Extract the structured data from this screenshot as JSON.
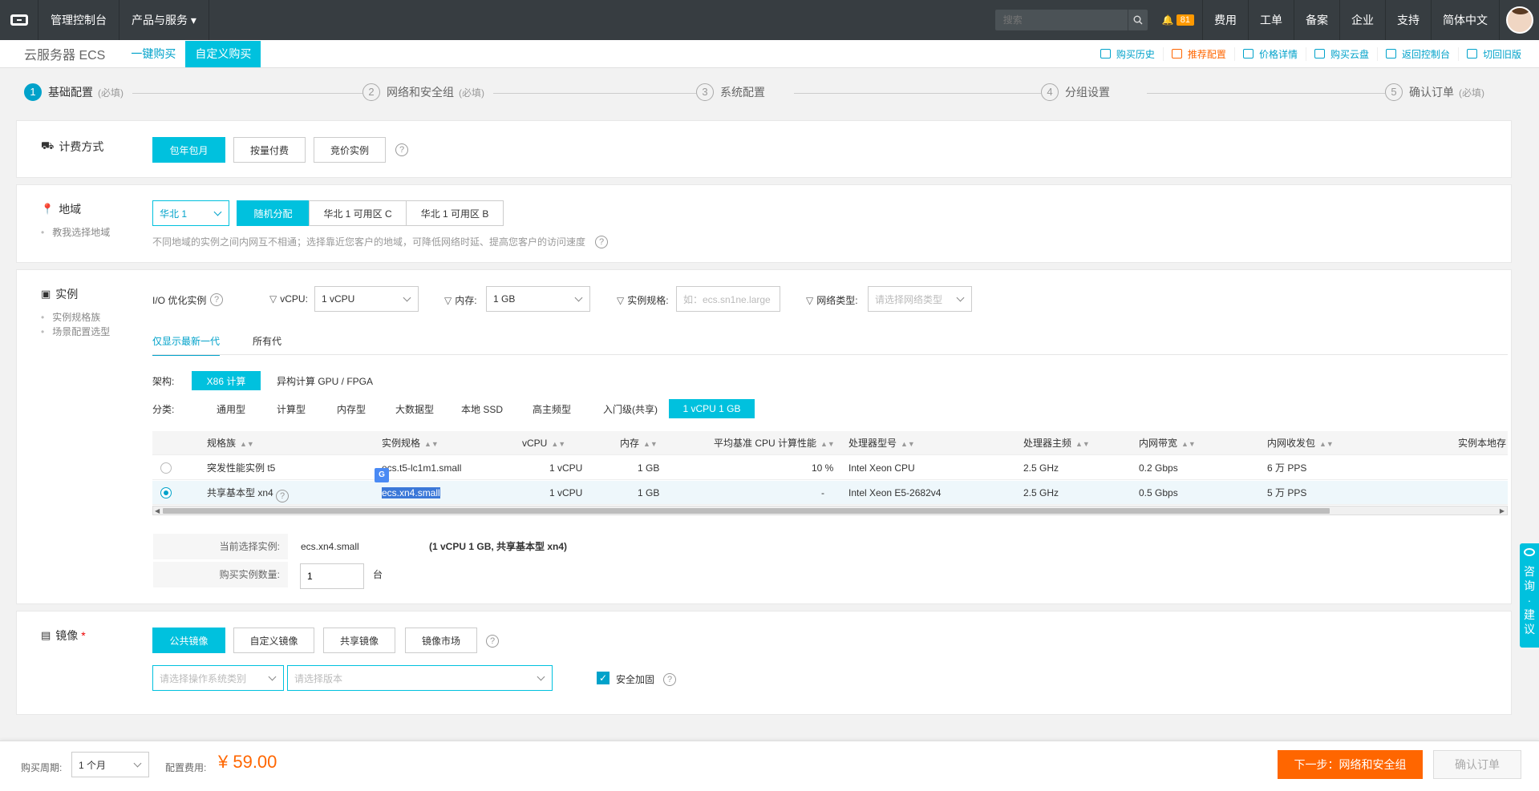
{
  "topbar": {
    "console": "管理控制台",
    "products": "产品与服务",
    "search_placeholder": "搜索",
    "notifications": "81",
    "links": [
      "费用",
      "工单",
      "备案",
      "企业",
      "支持",
      "简体中文"
    ]
  },
  "subbar": {
    "title": "云服务器 ECS",
    "tabs": [
      "一键购买",
      "自定义购买"
    ],
    "links": [
      "购买历史",
      "推荐配置",
      "价格详情",
      "购买云盘",
      "返回控制台",
      "切回旧版"
    ]
  },
  "steps": [
    {
      "num": "1",
      "label": "基础配置",
      "req": "(必填)"
    },
    {
      "num": "2",
      "label": "网络和安全组",
      "req": "(必填)"
    },
    {
      "num": "3",
      "label": "系统配置",
      "req": ""
    },
    {
      "num": "4",
      "label": "分组设置",
      "req": ""
    },
    {
      "num": "5",
      "label": "确认订单",
      "req": "(必填)"
    }
  ],
  "billing": {
    "title": "计费方式",
    "options": [
      "包年包月",
      "按量付费",
      "竞价实例"
    ]
  },
  "region": {
    "title": "地域",
    "sub": "教我选择地域",
    "selected": "华北 1",
    "zones": [
      "随机分配",
      "华北 1 可用区 C",
      "华北 1 可用区 B"
    ],
    "hint": "不同地域的实例之间内网互不相通；选择靠近您客户的地域，可降低网络时延、提高您客户的访问速度"
  },
  "instance": {
    "title": "实例",
    "subs": [
      "实例规格族",
      "场景配置选型"
    ],
    "io_label": "I/O 优化实例",
    "filters": {
      "vcpu_label": "vCPU:",
      "vcpu_value": "1 vCPU",
      "mem_label": "内存:",
      "mem_value": "1 GB",
      "spec_label": "实例规格:",
      "spec_placeholder": "如：ecs.sn1ne.large",
      "net_label": "网络类型:",
      "net_placeholder": "请选择网络类型"
    },
    "gen_tabs": [
      "仅显示最新一代",
      "所有代"
    ],
    "arch_label": "架构:",
    "arch": [
      "X86 计算",
      "异构计算 GPU / FPGA"
    ],
    "cat_label": "分类:",
    "categories": [
      "通用型",
      "计算型",
      "内存型",
      "大数据型",
      "本地 SSD",
      "高主频型",
      "入门级(共享)",
      "1 vCPU 1 GB"
    ],
    "columns": [
      "规格族",
      "实例规格",
      "vCPU",
      "内存",
      "平均基准 CPU 计算性能",
      "处理器型号",
      "处理器主频",
      "内网带宽",
      "内网收发包",
      "实例本地存"
    ],
    "rows": [
      [
        "突发性能实例 t5",
        "ecs.t5-lc1m1.small",
        "1 vCPU",
        "1 GB",
        "10 %",
        "Intel Xeon CPU",
        "2.5 GHz",
        "0.2 Gbps",
        "6 万 PPS"
      ],
      [
        "共享基本型 xn4",
        "ecs.xn4.small",
        "1 vCPU",
        "1 GB",
        "-",
        "Intel Xeon E5-2682v4",
        "2.5 GHz",
        "0.5 Gbps",
        "5 万 PPS"
      ]
    ],
    "trans_icon": "G",
    "current_label": "当前选择实例:",
    "current_value": "ecs.xn4.small",
    "current_desc": "(1 vCPU 1 GB, 共享基本型 xn4)",
    "qty_label": "购买实例数量:",
    "qty_value": "1",
    "qty_unit": "台"
  },
  "image": {
    "title": "镜像",
    "star": "*",
    "types": [
      "公共镜像",
      "自定义镜像",
      "共享镜像",
      "镜像市场"
    ],
    "os_placeholder": "请选择操作系统类别",
    "ver_placeholder": "请选择版本",
    "security": "安全加固"
  },
  "consult": [
    "咨",
    "询",
    "·",
    "建",
    "议"
  ],
  "footer": {
    "period_label": "购买周期:",
    "period_value": "1 个月",
    "fee_label": "配置费用:",
    "price": "¥ 59.00",
    "next": "下一步：网络和安全组",
    "confirm": "确认订单"
  },
  "colors": {
    "accent": "#00c1de",
    "link": "#00a2ca",
    "orange": "#ff6600",
    "topbar": "#373d41"
  }
}
